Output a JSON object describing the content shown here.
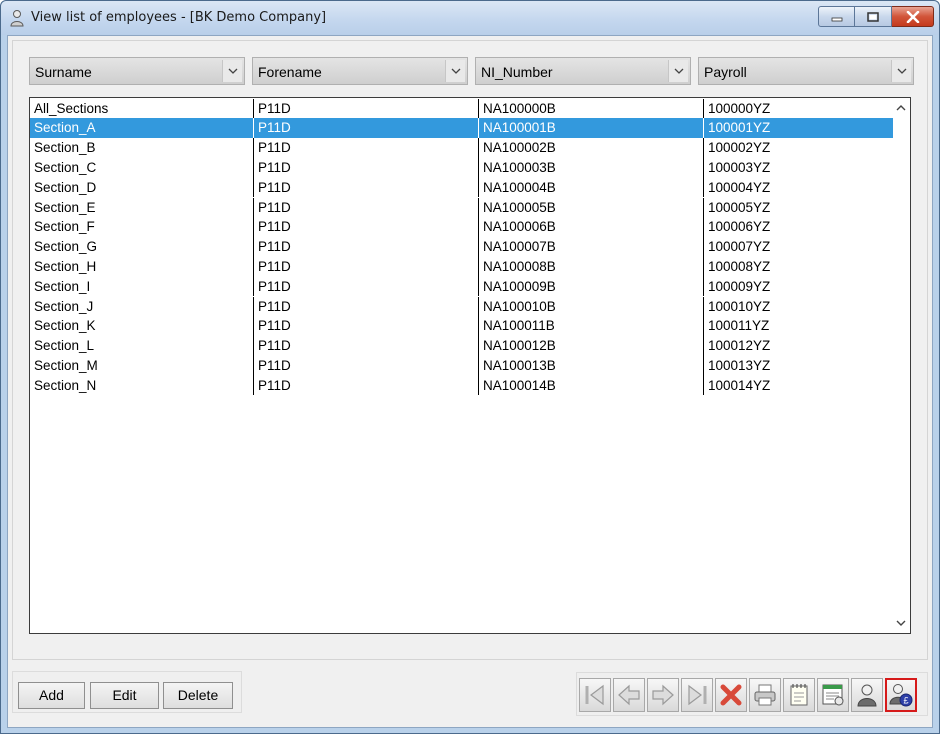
{
  "window": {
    "title": "View list of employees - [BK Demo Company]"
  },
  "columns": [
    {
      "label": "Surname"
    },
    {
      "label": "Forename"
    },
    {
      "label": "NI_Number"
    },
    {
      "label": "Payroll"
    }
  ],
  "rows": [
    {
      "surname": "All_Sections",
      "forename": "P11D",
      "ni": "NA100000B",
      "payroll": "100000YZ",
      "selected": false
    },
    {
      "surname": "Section_A",
      "forename": "P11D",
      "ni": "NA100001B",
      "payroll": "100001YZ",
      "selected": true
    },
    {
      "surname": "Section_B",
      "forename": "P11D",
      "ni": "NA100002B",
      "payroll": "100002YZ",
      "selected": false
    },
    {
      "surname": "Section_C",
      "forename": "P11D",
      "ni": "NA100003B",
      "payroll": "100003YZ",
      "selected": false
    },
    {
      "surname": "Section_D",
      "forename": "P11D",
      "ni": "NA100004B",
      "payroll": "100004YZ",
      "selected": false
    },
    {
      "surname": "Section_E",
      "forename": "P11D",
      "ni": "NA100005B",
      "payroll": "100005YZ",
      "selected": false
    },
    {
      "surname": "Section_F",
      "forename": "P11D",
      "ni": "NA100006B",
      "payroll": "100006YZ",
      "selected": false
    },
    {
      "surname": "Section_G",
      "forename": "P11D",
      "ni": "NA100007B",
      "payroll": "100007YZ",
      "selected": false
    },
    {
      "surname": "Section_H",
      "forename": "P11D",
      "ni": "NA100008B",
      "payroll": "100008YZ",
      "selected": false
    },
    {
      "surname": "Section_I",
      "forename": "P11D",
      "ni": "NA100009B",
      "payroll": "100009YZ",
      "selected": false
    },
    {
      "surname": "Section_J",
      "forename": "P11D",
      "ni": "NA100010B",
      "payroll": "100010YZ",
      "selected": false
    },
    {
      "surname": "Section_K",
      "forename": "P11D",
      "ni": "NA100011B",
      "payroll": "100011YZ",
      "selected": false
    },
    {
      "surname": "Section_L",
      "forename": "P11D",
      "ni": "NA100012B",
      "payroll": "100012YZ",
      "selected": false
    },
    {
      "surname": "Section_M",
      "forename": "P11D",
      "ni": "NA100013B",
      "payroll": "100013YZ",
      "selected": false
    },
    {
      "surname": "Section_N",
      "forename": "P11D",
      "ni": "NA100014B",
      "payroll": "100014YZ",
      "selected": false
    }
  ],
  "buttons": {
    "add": "Add",
    "edit": "Edit",
    "delete": "Delete"
  },
  "toolbar": [
    {
      "icon": "first-record-icon"
    },
    {
      "icon": "previous-record-icon"
    },
    {
      "icon": "next-record-icon"
    },
    {
      "icon": "last-record-icon"
    },
    {
      "icon": "delete-record-icon"
    },
    {
      "icon": "print-icon"
    },
    {
      "icon": "notepad-icon"
    },
    {
      "icon": "report-icon"
    },
    {
      "icon": "employee-icon"
    },
    {
      "icon": "employee-pay-icon",
      "highlighted": true
    }
  ],
  "colors": {
    "selection": "#3399dd",
    "highlight_border": "#d61a1a",
    "title_bar": "#c3d6ee"
  }
}
